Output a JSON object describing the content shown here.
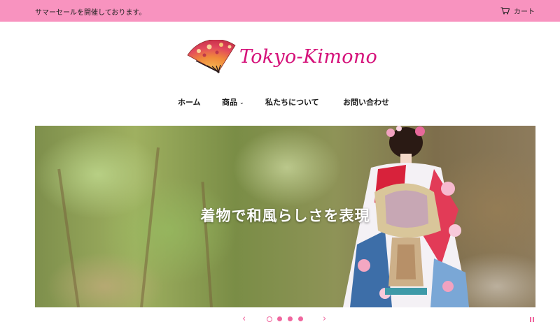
{
  "announcement": {
    "text": "サマーセールを開催しております。"
  },
  "header": {
    "cart_label": "カート",
    "logo_text": "Tokyo-Kimono"
  },
  "nav": {
    "items": [
      {
        "label": "ホーム"
      },
      {
        "label": "商品"
      },
      {
        "label": "私たちについて"
      },
      {
        "label": "お問い合わせ"
      }
    ]
  },
  "hero": {
    "caption": "着物で和風らしさを表現",
    "slide_count": 4,
    "active_slide": 1
  },
  "colors": {
    "announcement_bg": "#f893bf",
    "brand": "#d5127a",
    "slider_control": "#f0669e"
  },
  "icons": {
    "cart": "cart-icon",
    "fan": "fan-logo-icon",
    "prev": "chevron-left-icon",
    "next": "chevron-right-icon",
    "pause": "pause-icon",
    "dropdown": "chevron-down-icon"
  }
}
